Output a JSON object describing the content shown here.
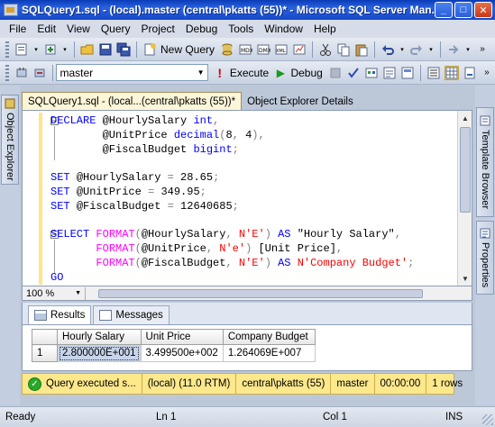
{
  "window": {
    "title": "SQLQuery1.sql - (local).master (central\\pkatts (55))* - Microsoft SQL Server Man...",
    "min_label": "_",
    "max_label": "□",
    "close_label": "✕"
  },
  "menu": [
    "File",
    "Edit",
    "View",
    "Query",
    "Project",
    "Debug",
    "Tools",
    "Window",
    "Help"
  ],
  "toolbar1": {
    "new_query_label": "New Query"
  },
  "toolbar2": {
    "database": "master",
    "execute_label": "Execute",
    "debug_label": "Debug"
  },
  "side": {
    "left_tab": "Object Explorer",
    "right_tab1": "Template Browser",
    "right_tab2": "Properties"
  },
  "doc_tabs": {
    "active": "SQLQuery1.sql - (local...(central\\pkatts (55))*",
    "inactive": "Object Explorer Details"
  },
  "editor": {
    "zoom": "100 %",
    "lines": [
      [
        {
          "t": "DECLARE ",
          "c": "kw"
        },
        {
          "t": "@HourlySalary ",
          "c": ""
        },
        {
          "t": "int",
          "c": "kw"
        },
        {
          "t": ",",
          "c": "op"
        }
      ],
      [
        {
          "t": "        @UnitPrice ",
          "c": ""
        },
        {
          "t": "decimal",
          "c": "kw"
        },
        {
          "t": "(",
          "c": "op"
        },
        {
          "t": "8",
          "c": ""
        },
        {
          "t": ", ",
          "c": "op"
        },
        {
          "t": "4",
          "c": ""
        },
        {
          "t": "),",
          "c": "op"
        }
      ],
      [
        {
          "t": "        @FiscalBudget ",
          "c": ""
        },
        {
          "t": "bigint",
          "c": "kw"
        },
        {
          "t": ";",
          "c": "op"
        }
      ],
      [],
      [
        {
          "t": "SET ",
          "c": "kw"
        },
        {
          "t": "@HourlySalary ",
          "c": ""
        },
        {
          "t": "= ",
          "c": "op"
        },
        {
          "t": "28.65",
          "c": ""
        },
        {
          "t": ";",
          "c": "op"
        }
      ],
      [
        {
          "t": "SET ",
          "c": "kw"
        },
        {
          "t": "@UnitPrice ",
          "c": ""
        },
        {
          "t": "= ",
          "c": "op"
        },
        {
          "t": "349.95",
          "c": ""
        },
        {
          "t": ";",
          "c": "op"
        }
      ],
      [
        {
          "t": "SET ",
          "c": "kw"
        },
        {
          "t": "@FiscalBudget ",
          "c": ""
        },
        {
          "t": "= ",
          "c": "op"
        },
        {
          "t": "12640685",
          "c": ""
        },
        {
          "t": ";",
          "c": "op"
        }
      ],
      [],
      [
        {
          "t": "SELECT ",
          "c": "kw"
        },
        {
          "t": "FORMAT",
          "c": "fn"
        },
        {
          "t": "(",
          "c": "op"
        },
        {
          "t": "@HourlySalary",
          "c": ""
        },
        {
          "t": ", ",
          "c": "op"
        },
        {
          "t": "N'E'",
          "c": "str"
        },
        {
          "t": ") ",
          "c": "op"
        },
        {
          "t": "AS ",
          "c": "kw"
        },
        {
          "t": "\"Hourly Salary\"",
          "c": ""
        },
        {
          "t": ",",
          "c": "op"
        }
      ],
      [
        {
          "t": "       ",
          "c": ""
        },
        {
          "t": "FORMAT",
          "c": "fn"
        },
        {
          "t": "(",
          "c": "op"
        },
        {
          "t": "@UnitPrice",
          "c": ""
        },
        {
          "t": ", ",
          "c": "op"
        },
        {
          "t": "N'e'",
          "c": "str"
        },
        {
          "t": ") ",
          "c": "op"
        },
        {
          "t": "[Unit Price]",
          "c": ""
        },
        {
          "t": ",",
          "c": "op"
        }
      ],
      [
        {
          "t": "       ",
          "c": ""
        },
        {
          "t": "FORMAT",
          "c": "fn"
        },
        {
          "t": "(",
          "c": "op"
        },
        {
          "t": "@FiscalBudget",
          "c": ""
        },
        {
          "t": ", ",
          "c": "op"
        },
        {
          "t": "N'E'",
          "c": "str"
        },
        {
          "t": ") ",
          "c": "op"
        },
        {
          "t": "AS ",
          "c": "kw"
        },
        {
          "t": "N'Company Budget'",
          "c": "str"
        },
        {
          "t": ";",
          "c": "op"
        }
      ],
      [
        {
          "t": "GO",
          "c": "kw"
        }
      ]
    ]
  },
  "results": {
    "tabs": [
      "Results",
      "Messages"
    ],
    "columns": [
      "Hourly Salary",
      "Unit Price",
      "Company Budget"
    ],
    "rows": [
      {
        "num": "1",
        "cells": [
          "2.800000E+001",
          "3.499500e+002",
          "1.264069E+007"
        ]
      }
    ]
  },
  "exec_status": {
    "message": "Query executed s...",
    "server": "(local) (11.0 RTM)",
    "user": "central\\pkatts (55)",
    "database": "master",
    "elapsed": "00:00:00",
    "rows": "1 rows"
  },
  "status": {
    "ready": "Ready",
    "line": "Ln 1",
    "col": "Col 1",
    "mode": "INS"
  },
  "colors": {
    "keyword": "#0000ff",
    "function": "#ff00ff",
    "string": "#ff0000",
    "operator": "#808080",
    "exec_bar": "#fde88c"
  }
}
